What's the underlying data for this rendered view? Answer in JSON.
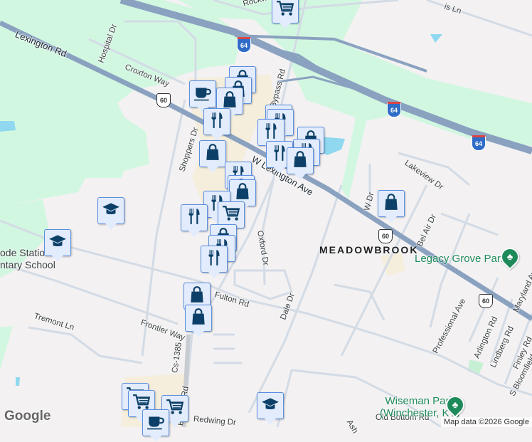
{
  "roads": {
    "lexington_rd": "Lexington Rd",
    "w_lexington_ave": "W Lexington Ave",
    "hospital_dr": "Hospital Dr",
    "croxton_way": "Croxton Way",
    "shoppers_dr": "Shoppers Dr",
    "rockwell": "Rockwell Rd",
    "bypass_rd_north": "Bypass Rd",
    "bypass_rd_south": "Bypass Rd",
    "cs_1385": "Cs-1385",
    "oxford_dr": "Oxford Dr",
    "dale_dr": "Dale Dr",
    "fulton_rd": "Fulton Rd",
    "frontier_way": "Frontier Way",
    "tremont_ln": "Tremont Ln",
    "redwing_dr": "Redwing Dr",
    "lakeview_dr": "Lakeview Dr",
    "bel_air_dr": "Bel Air Dr",
    "w_dr": "W Dr",
    "professional_ave": "Professional Ave",
    "arlington_rd": "Arlington Rd",
    "lindberg_rd": "Lindberg Rd",
    "finley_rd": "Finley Rd",
    "maryland": "Maryland Ave",
    "s_bloomfield": "S Bloomfield",
    "old_bottom_rd": "Old Bottom Rd",
    "ash": "Ash",
    "top_ln": "is Ln"
  },
  "shields": {
    "i64": "64",
    "us60": "60"
  },
  "places": {
    "neighborhood": "MEADOWBROOK",
    "legacy_grove_park": "Legacy Grove Park",
    "wiseman_park_line1": "Wiseman Park",
    "wiseman_park_line2": "(Winchester, KY)",
    "school": "ode Station Elementary School",
    "school_line1": "ode Statio",
    "school_line2": "ntary School"
  },
  "marker_types": [
    "shopping-bag",
    "restaurant",
    "grocery-cart",
    "coffee",
    "school"
  ],
  "footer": {
    "google_logo": "Google",
    "attribution": "Map data ©2026 Google"
  },
  "colors": {
    "marker_bg": "#e3ecfc",
    "marker_border": "#5a8ee0",
    "icon": "#0d4068",
    "highway": "#8aa2c0",
    "park": "#d2f7e1",
    "road": "#d3dbe5"
  }
}
